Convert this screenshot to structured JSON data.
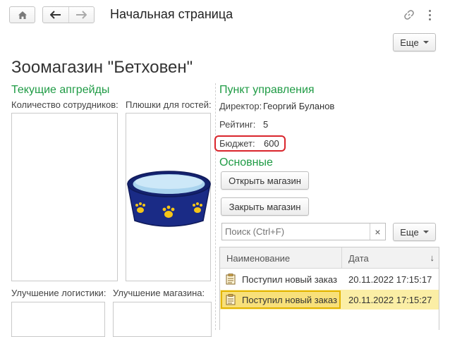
{
  "toolbar": {
    "home_icon": "home-icon",
    "back_icon": "arrow-left-icon",
    "forward_icon": "arrow-right-icon",
    "title": "Начальная страница",
    "link_icon": "link-icon",
    "menu_icon": "more-vertical-icon"
  },
  "top_more_label": "Еще",
  "page_title": "Зоомагазин \"Бетховен\"",
  "upgrades": {
    "heading": "Текущие апгрейды",
    "staff_label": "Количество сотрудников:",
    "goodies_label": "Плюшки для гостей:",
    "logistics_label": "Улучшение логистики:",
    "store_label": "Улучшение магазина:"
  },
  "control": {
    "heading": "Пункт управления",
    "director_label": "Директор:",
    "director_value": "Георгий Буланов",
    "rating_label": "Рейтинг:",
    "rating_value": "5",
    "budget_label": "Бюджет:",
    "budget_value": "600"
  },
  "main": {
    "heading": "Основные",
    "open_label": "Открыть магазин",
    "close_label": "Закрыть магазин"
  },
  "search": {
    "placeholder": "Поиск (Ctrl+F)",
    "clear": "×",
    "more_label": "Еще"
  },
  "table": {
    "col_name": "Наименование",
    "col_date": "Дата",
    "sort_arrow": "↓",
    "rows": [
      {
        "name": "Поступил новый заказ",
        "date": "20.11.2022 17:15:17"
      },
      {
        "name": "Поступил новый заказ",
        "date": "20.11.2022 17:15:27"
      }
    ]
  },
  "colors": {
    "accent_green": "#1f9b45",
    "highlight_red": "#d9252c",
    "selected_row": "#fbeea5",
    "bowl_blue": "#1a2b86",
    "paw_yellow": "#f5c518"
  }
}
